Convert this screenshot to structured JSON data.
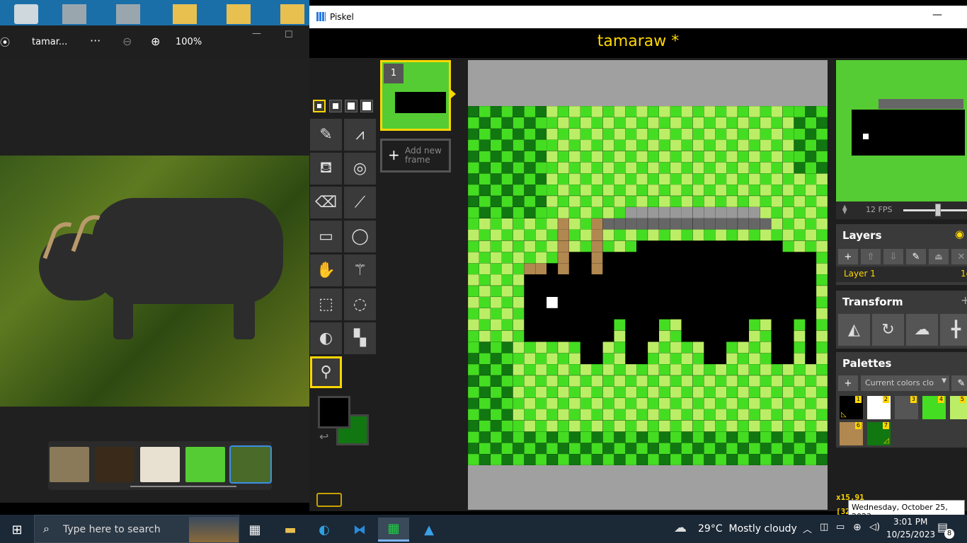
{
  "photos": {
    "filename": "tamar...",
    "more": "···",
    "zoom": "100%"
  },
  "piskel": {
    "window_title": "Piskel",
    "doc_title": "tamaraw *",
    "frame_number": "1",
    "add_frame": "Add new frame",
    "fps": "12 FPS",
    "layers_title": "Layers",
    "layer_name": "Layer 1",
    "layer_opacity": "1c",
    "transform_title": "Transform",
    "palettes_title": "Palettes",
    "palette_select": "Current colors clo",
    "palette_numbers": [
      "1",
      "2",
      "3",
      "4",
      "5",
      "6",
      "7"
    ],
    "zoom_readout": "x15.91",
    "cursor_readout": "[32",
    "primary_color": "#000000",
    "secondary_color": "#117711"
  },
  "taskbar": {
    "search_placeholder": "Type here to search",
    "weather": "29°C  Mostly cloudy",
    "time": "3:01 PM",
    "date": "10/25/2023",
    "notif_count": "8"
  },
  "tooltip": "Wednesday, October 25, 2023"
}
